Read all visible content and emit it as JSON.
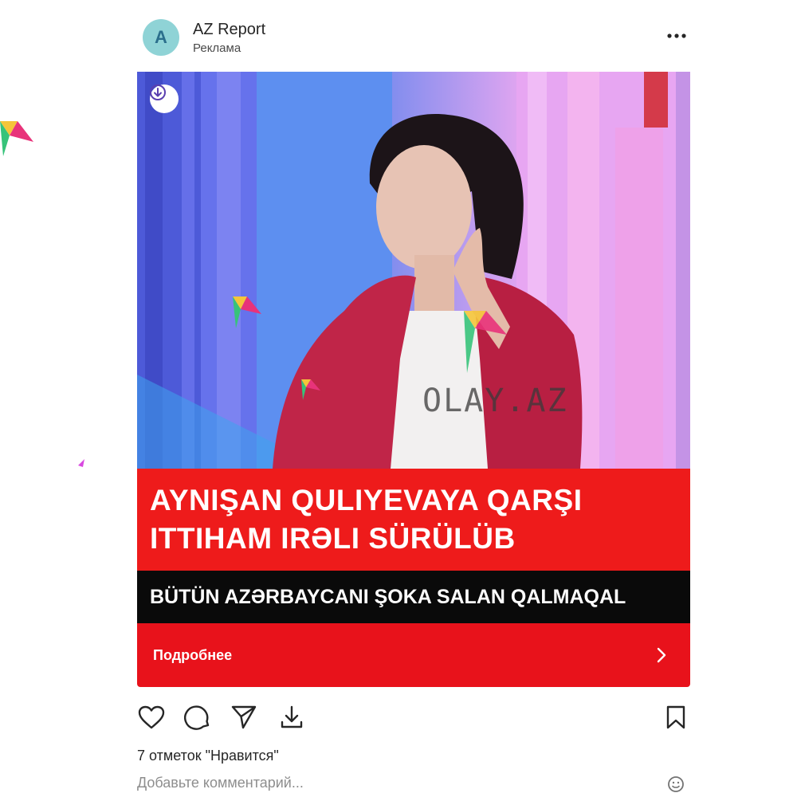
{
  "account": {
    "initial": "A",
    "name": "AZ Report",
    "subtitle": "Реклама"
  },
  "media": {
    "watermark": "OLAY.AZ",
    "headline_line1": "AYNIŞAN QULIYEVAYA QARŞI",
    "headline_line2": "ITTIHAM IRƏLI SÜRÜLÜB",
    "subheadline": "BÜTÜN AZƏRBAYCANI ŞOKA SALAN QALMAQAL"
  },
  "cta": {
    "label": "Подробнее",
    "icon": "chevron-right-icon"
  },
  "actions": {
    "icons": [
      "heart-icon",
      "comment-icon",
      "share-icon",
      "download-icon",
      "bookmark-icon"
    ]
  },
  "likes_text": "7 отметок \"Нравится\"",
  "comment": {
    "placeholder": "Добавьте комментарий...",
    "value": ""
  },
  "colors": {
    "headline_bg": "#ee1b1b",
    "subline_bg": "#0a0a0a",
    "cta_bg": "#e8121b",
    "avatar_bg": "#8fd3d6"
  }
}
